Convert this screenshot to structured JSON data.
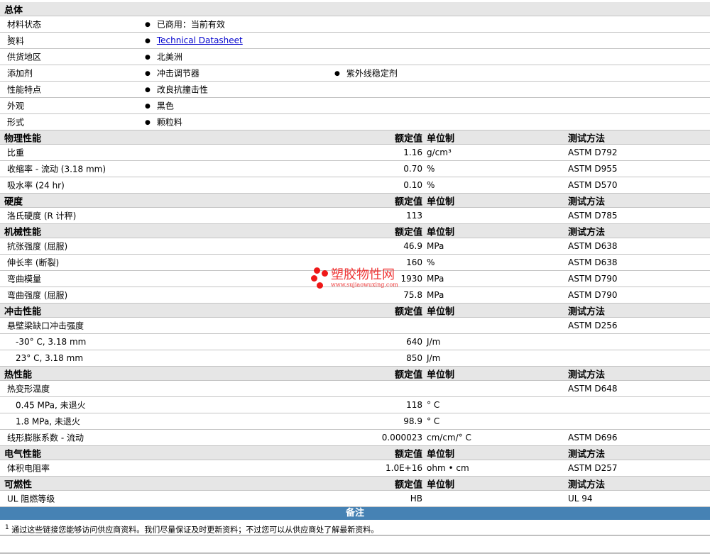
{
  "headers": {
    "value": "额定值",
    "unit": "单位制",
    "method": "测试方法"
  },
  "sections": [
    {
      "title": "总体",
      "show_cols": false,
      "rows": [
        {
          "label": "材料状态",
          "bullets": [
            "已商用：当前有效"
          ]
        },
        {
          "label": "资料",
          "sup": "1",
          "bullets": [
            "Technical Datasheet"
          ],
          "link": true
        },
        {
          "label": "供货地区",
          "bullets": [
            "北美洲"
          ]
        },
        {
          "label": "添加剂",
          "bullets": [
            "冲击调节器",
            "紫外线稳定剂"
          ]
        },
        {
          "label": "性能特点",
          "bullets": [
            "改良抗撞击性"
          ]
        },
        {
          "label": "外观",
          "bullets": [
            "黑色"
          ]
        },
        {
          "label": "形式",
          "bullets": [
            "颗粒料"
          ]
        }
      ]
    },
    {
      "title": "物理性能",
      "show_cols": true,
      "rows": [
        {
          "label": "比重",
          "value": "1.16",
          "unit": "g/cm³",
          "method": "ASTM D792"
        },
        {
          "label": "收缩率 - 流动 (3.18 mm)",
          "value": "0.70",
          "unit": "%",
          "method": "ASTM D955"
        },
        {
          "label": "吸水率 (24 hr)",
          "value": "0.10",
          "unit": "%",
          "method": "ASTM D570"
        }
      ]
    },
    {
      "title": "硬度",
      "show_cols": true,
      "rows": [
        {
          "label": "洛氏硬度 (R 计秤)",
          "value": "113",
          "unit": "",
          "method": "ASTM D785"
        }
      ]
    },
    {
      "title": "机械性能",
      "show_cols": true,
      "rows": [
        {
          "label": "抗张强度 (屈服)",
          "value": "46.9",
          "unit": "MPa",
          "method": "ASTM D638"
        },
        {
          "label": "伸长率 (断裂)",
          "value": "160",
          "unit": "%",
          "method": "ASTM D638"
        },
        {
          "label": "弯曲模量",
          "value": "1930",
          "unit": "MPa",
          "method": "ASTM D790"
        },
        {
          "label": "弯曲强度 (屈服)",
          "value": "75.8",
          "unit": "MPa",
          "method": "ASTM D790"
        }
      ]
    },
    {
      "title": "冲击性能",
      "show_cols": true,
      "rows": [
        {
          "label": "悬壁梁缺口冲击强度",
          "value": "",
          "unit": "",
          "method": "ASTM D256"
        },
        {
          "label": "-30° C, 3.18 mm",
          "sub": true,
          "value": "640",
          "unit": "J/m",
          "method": ""
        },
        {
          "label": "23° C, 3.18 mm",
          "sub": true,
          "value": "850",
          "unit": "J/m",
          "method": ""
        }
      ]
    },
    {
      "title": "热性能",
      "show_cols": true,
      "rows": [
        {
          "label": "热变形温度",
          "value": "",
          "unit": "",
          "method": "ASTM D648"
        },
        {
          "label": "0.45 MPa, 未退火",
          "sub": true,
          "value": "118",
          "unit": "° C",
          "method": ""
        },
        {
          "label": "1.8 MPa, 未退火",
          "sub": true,
          "value": "98.9",
          "unit": "° C",
          "method": ""
        },
        {
          "label": "线形膨胀系数 - 流动",
          "value": "0.000023",
          "unit": "cm/cm/° C",
          "method": "ASTM D696"
        }
      ]
    },
    {
      "title": "电气性能",
      "show_cols": true,
      "rows": [
        {
          "label": "体积电阻率",
          "value": "1.0E+16",
          "unit": "ohm • cm",
          "method": "ASTM D257"
        }
      ]
    },
    {
      "title": "可燃性",
      "show_cols": true,
      "rows": [
        {
          "label": "UL 阻燃等级",
          "value": "HB",
          "unit": "",
          "method": "UL 94"
        }
      ]
    }
  ],
  "notes": {
    "title": "备注",
    "sup": "1",
    "text": "通过这些链接您能够访问供应商资料。我们尽量保证及时更新资料；不过您可以从供应商处了解最新资料。"
  },
  "watermark": {
    "name": "塑胶物性网",
    "url": "www.sujiaowuxing.com"
  }
}
